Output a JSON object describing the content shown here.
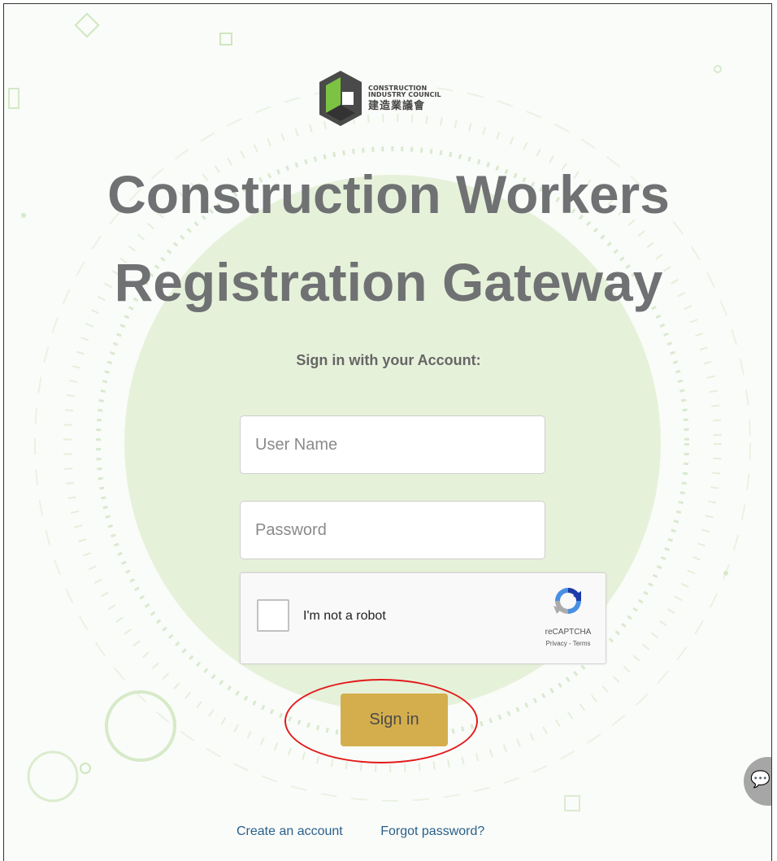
{
  "logo": {
    "line1": "CONSTRUCTION",
    "line2": "INDUSTRY COUNCIL",
    "chinese": "建造業議會",
    "icon": "cic-logo-icon"
  },
  "title": {
    "line1": "Construction Workers",
    "line2": "Registration Gateway"
  },
  "subtitle": "Sign in with your Account:",
  "form": {
    "username_placeholder": "User Name",
    "password_placeholder": "Password",
    "username_value": "",
    "password_value": ""
  },
  "recaptcha": {
    "label": "I'm not a robot",
    "brand": "reCAPTCHA",
    "links": "Privacy - Terms",
    "icon": "recaptcha-icon"
  },
  "signin_label": "Sign in",
  "links": {
    "create": "Create an account",
    "forgot": "Forgot password?"
  },
  "chat_icon": "chat-icon",
  "colors": {
    "accent_button": "#d4ae4d",
    "title_text": "#6f7173",
    "link": "#2a5f8a",
    "highlight": "#e21b1b",
    "bg_circle": "#e4f1d7"
  }
}
